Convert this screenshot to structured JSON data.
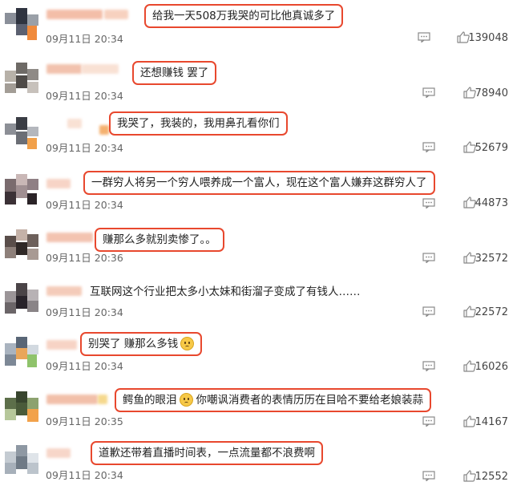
{
  "icons": {
    "reply": "reply-comment-icon",
    "like": "thumbs-up-icon",
    "emoji": "smiling-face-emoji-icon",
    "tear_emoji": "crying-face-emoji-icon"
  },
  "colors": {
    "highlight_border": "#e8482e",
    "text": "#222222",
    "meta": "#666666"
  },
  "comments": [
    {
      "time": "09月11日 20:34",
      "text": "给我一天508万我哭的可比他真诚多了",
      "likes": "139048"
    },
    {
      "time": "09月11日 20:34",
      "text": "还想赚钱 罢了",
      "likes": "78940"
    },
    {
      "time": "09月11日 20:34",
      "text": "我哭了，我装的，我用鼻孔看你们",
      "likes": "52679"
    },
    {
      "time": "09月11日 20:34",
      "text": "一群穷人将另一个穷人喂养成一个富人，现在这个富人嫌弃这群穷人了",
      "likes": "44873"
    },
    {
      "time": "09月11日 20:36",
      "text": "赚那么多就别卖惨了。。",
      "likes": "32572"
    },
    {
      "time": "09月11日 20:34",
      "text": "互联网这个行业把太多小太妹和街溜子变成了有钱人……",
      "likes": "22572"
    },
    {
      "time": "09月11日 20:34",
      "text": "别哭了 赚那么多钱",
      "likes": "16026"
    },
    {
      "time": "09月11日 20:35",
      "text_a": "鳄鱼的眼泪",
      "text_b": "你嘲讽消费者的表情历历在目哈不要给老娘装蒜",
      "likes": "14167"
    },
    {
      "time": "09月11日 20:34",
      "text": "道歉还带着直播时间表，一点流量都不浪费啊",
      "likes": "12552"
    }
  ]
}
